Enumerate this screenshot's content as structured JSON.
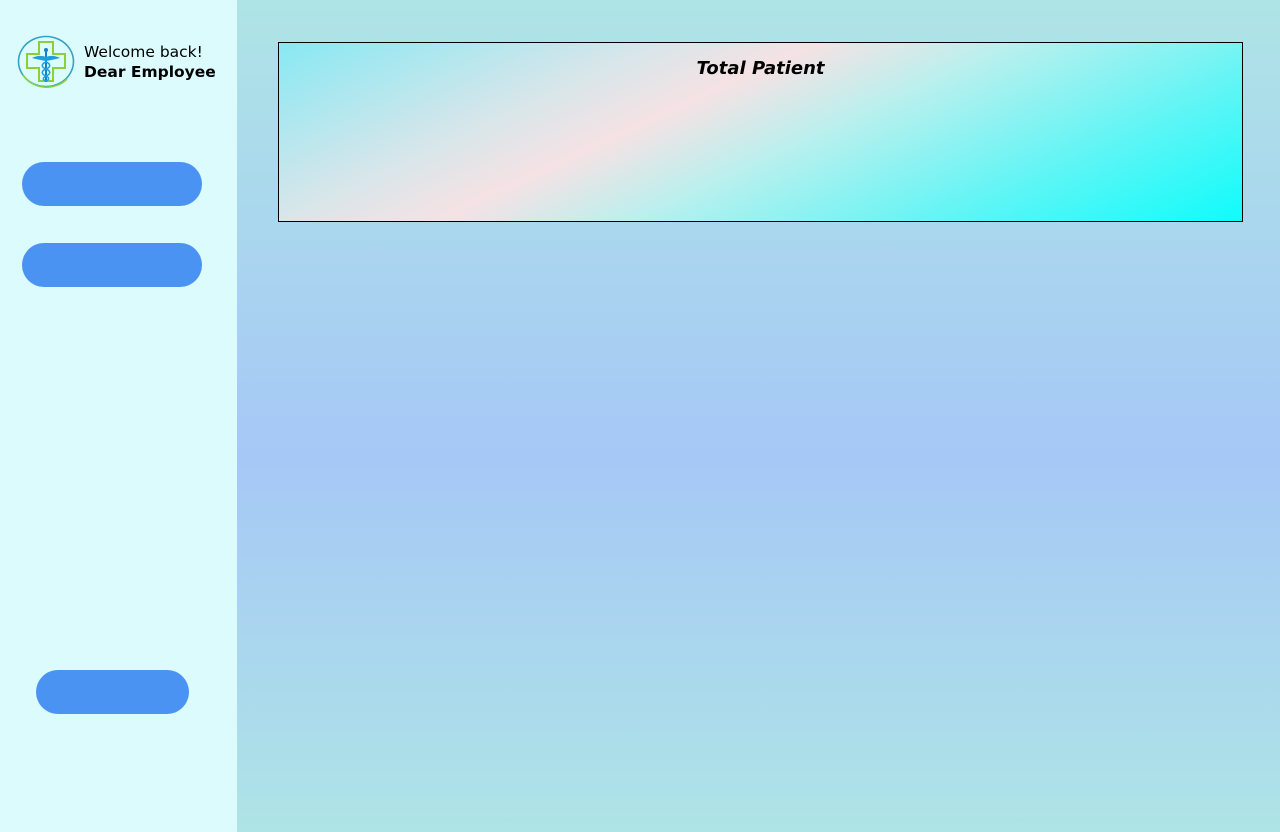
{
  "sidebar": {
    "greeting": "Welcome back!",
    "user_name": "Dear Employee",
    "logo_icon": "medical-cross-caduceus-icon",
    "buttons": [
      {
        "label": ""
      },
      {
        "label": ""
      },
      {
        "label": ""
      }
    ]
  },
  "main": {
    "card": {
      "title": "Total Patient"
    }
  },
  "colors": {
    "sidebar_bg": "#dcfbfc",
    "button_blue": "#4b93f3",
    "main_bg_top": "#aee4e6",
    "main_bg_mid": "#a6c8f6",
    "card_gradient_start": "#88e8f3",
    "card_gradient_end": "#0ffcfb"
  }
}
